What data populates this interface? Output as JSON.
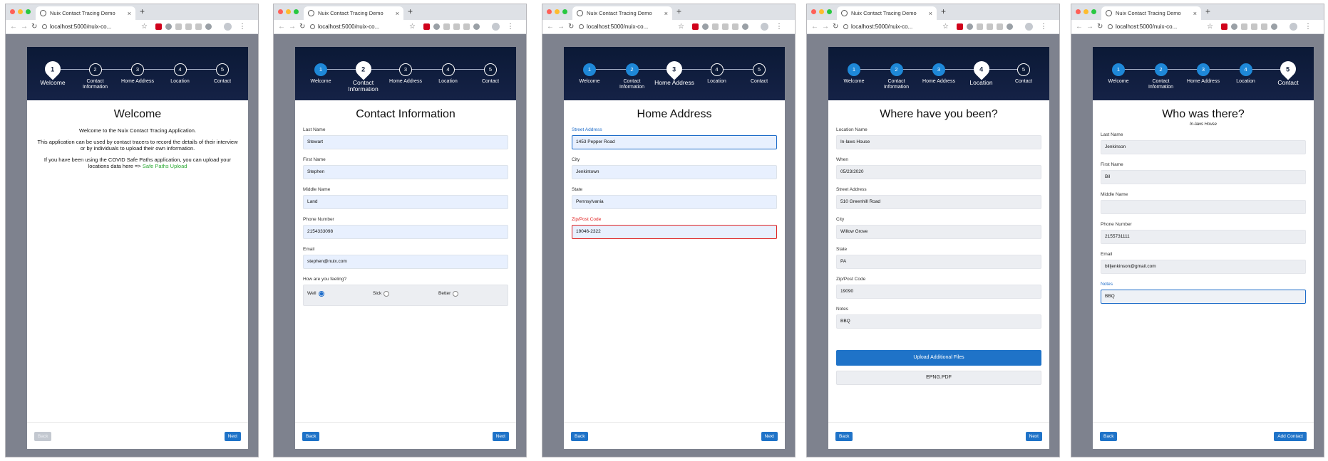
{
  "browser": {
    "tab_title": "Nuix Contact Tracing Demo",
    "tab_close": "×",
    "new_tab": "+",
    "back_glyph": "←",
    "forward_glyph": "→",
    "reload_glyph": "↻",
    "url": "localhost:5000/nuix-co...",
    "star_glyph": "☆",
    "menu_glyph": "⋮",
    "icons": [
      "globe-icon",
      "lock-icon",
      "star-icon",
      "extension-icon",
      "profile-icon",
      "menu-icon"
    ]
  },
  "steps": [
    {
      "number": "1",
      "label": "Welcome"
    },
    {
      "number": "2",
      "label": "Contact Information"
    },
    {
      "number": "3",
      "label": "Home Address"
    },
    {
      "number": "4",
      "label": "Location"
    },
    {
      "number": "5",
      "label": "Contact"
    }
  ],
  "buttons": {
    "back": "Back",
    "next": "Next",
    "add_contact": "Add Contact",
    "upload_files": "Upload Additional Files"
  },
  "colors": {
    "stepper_bg": "#0b1936",
    "step_done": "#1e88d8",
    "primary": "#1f73c8",
    "link": "#2aa832",
    "error": "#e02020"
  },
  "pages": {
    "welcome": {
      "title": "Welcome",
      "p1": "Welcome to the Nuix Contact Tracing Application.",
      "p2": "This application can be used by contact tracers to record the details of their interview or by individuals to upload their own information.",
      "p3": "If you have been using the COVID Safe Paths application, you can upload your locations data here =>",
      "link": "Safe Paths Upload"
    },
    "contact": {
      "title": "Contact Information",
      "fields": [
        {
          "label": "Last Name",
          "value": "Stewart"
        },
        {
          "label": "First Name",
          "value": "Stephen"
        },
        {
          "label": "Middle Name",
          "value": "Land"
        },
        {
          "label": "Phone Number",
          "value": "2154333098"
        },
        {
          "label": "Email",
          "value": "stephen@nuix.com"
        }
      ],
      "feeling_label": "How are you feeling?",
      "feeling_options": [
        "Well",
        "Sick",
        "Better"
      ],
      "feeling_selected": "Well"
    },
    "home": {
      "title": "Home Address",
      "fields": [
        {
          "label": "Street Address",
          "value": "1453 Pepper Road"
        },
        {
          "label": "City",
          "value": "Jenkintown"
        },
        {
          "label": "State",
          "value": "Pennsylvania"
        },
        {
          "label": "Zip/Post Code",
          "value": "19046-2322"
        }
      ]
    },
    "location": {
      "title": "Where have you been?",
      "fields": [
        {
          "label": "Location Name",
          "value": "In-laws House"
        },
        {
          "label": "When",
          "value": "05/23/2020"
        },
        {
          "label": "Street Address",
          "value": "510 Greenhill Road"
        },
        {
          "label": "City",
          "value": "Willow Grove"
        },
        {
          "label": "State",
          "value": "PA"
        },
        {
          "label": "Zip/Post Code",
          "value": "19090"
        },
        {
          "label": "Notes",
          "value": "BBQ"
        }
      ],
      "file_name": "EPNG.PDF"
    },
    "people": {
      "title": "Who was there?",
      "subtitle": "In-laws House",
      "fields": [
        {
          "label": "Last Name",
          "value": "Jenkinson"
        },
        {
          "label": "First Name",
          "value": "Bil"
        },
        {
          "label": "Middle Name",
          "value": ""
        },
        {
          "label": "Phone Number",
          "value": "2155731111"
        },
        {
          "label": "Email",
          "value": "billjenkinson@gmail.com"
        },
        {
          "label": "Notes",
          "value": "BBQ"
        }
      ]
    }
  }
}
